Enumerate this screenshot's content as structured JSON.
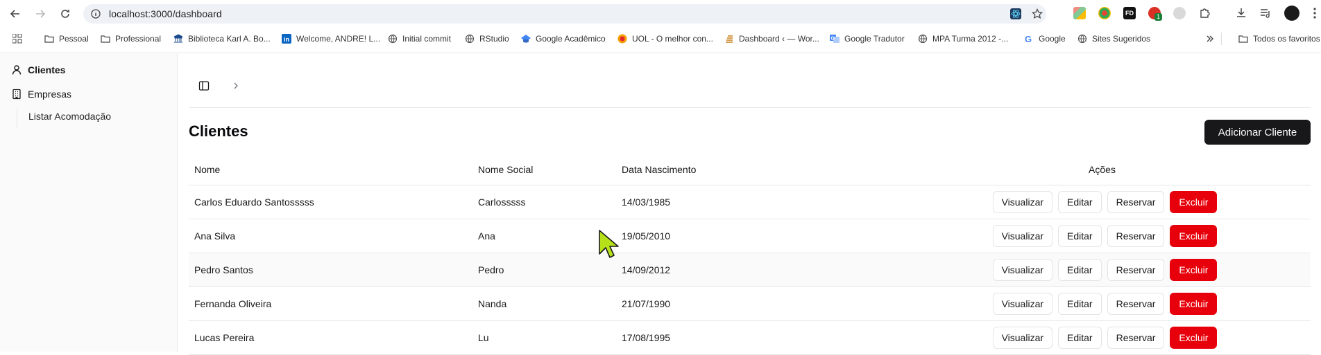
{
  "browser": {
    "url": "localhost:3000/dashboard",
    "bookmarks": [
      {
        "label": "Pessoal",
        "icon": "folder-icon"
      },
      {
        "label": "Professional",
        "icon": "folder-icon"
      },
      {
        "label": "Biblioteca Karl A. Bo...",
        "icon": "library-icon"
      },
      {
        "label": "Welcome, ANDRE! L...",
        "icon": "linkedin-icon"
      },
      {
        "label": "Initial commit",
        "icon": "globe-icon"
      },
      {
        "label": "RStudio",
        "icon": "globe-icon"
      },
      {
        "label": "Google Acadêmico",
        "icon": "scholar-icon"
      },
      {
        "label": "UOL - O melhor con...",
        "icon": "uol-icon"
      },
      {
        "label": "Dashboard ‹ — Wor...",
        "icon": "stack-icon"
      },
      {
        "label": "Google Tradutor",
        "icon": "translate-icon"
      },
      {
        "label": "MPA Turma 2012 -...",
        "icon": "globe-icon"
      },
      {
        "label": "Google",
        "icon": "google-icon"
      },
      {
        "label": "Sites Sugeridos",
        "icon": "globe-icon"
      }
    ],
    "other_bookmarks": "Todos os favoritos",
    "extension_badge": "1"
  },
  "sidebar": {
    "items": [
      {
        "label": "Clientes",
        "icon": "user-icon"
      },
      {
        "label": "Empresas",
        "icon": "building-icon"
      }
    ],
    "sub_item": "Listar Acomodação"
  },
  "main": {
    "title": "Clientes",
    "add_button": "Adicionar Cliente",
    "columns": [
      "Nome",
      "Nome Social",
      "Data Nascimento",
      "Ações"
    ],
    "rows": [
      {
        "nome": "Carlos Eduardo Santosssss",
        "social": "Carlosssss",
        "nascimento": "14/03/1985"
      },
      {
        "nome": "Ana Silva",
        "social": "Ana",
        "nascimento": "19/05/2010"
      },
      {
        "nome": "Pedro Santos",
        "social": "Pedro",
        "nascimento": "14/09/2012"
      },
      {
        "nome": "Fernanda Oliveira",
        "social": "Nanda",
        "nascimento": "21/07/1990"
      },
      {
        "nome": "Lucas Pereira",
        "social": "Lu",
        "nascimento": "17/08/1995"
      }
    ],
    "actions": {
      "view": "Visualizar",
      "edit": "Editar",
      "reserve": "Reservar",
      "delete": "Excluir"
    }
  },
  "colors": {
    "danger": "#e7000b",
    "primary": "#18181b",
    "cursor": "#b6e11a"
  }
}
